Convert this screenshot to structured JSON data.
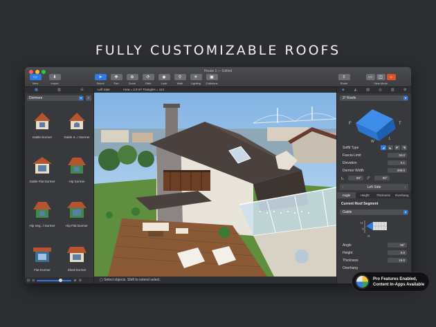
{
  "promo": {
    "title": "FULLY CUSTOMIZABLE ROOFS"
  },
  "window": {
    "document_title": "House 1 — Edited"
  },
  "toolbar": {
    "left": [
      {
        "label": "View",
        "icon": "view-icon"
      },
      {
        "label": "Import",
        "icon": "import-icon"
      }
    ],
    "tools": [
      {
        "label": "Select",
        "icon": "select-icon",
        "active": true
      },
      {
        "label": "Pan",
        "icon": "pan-icon"
      },
      {
        "label": "Zoom",
        "icon": "zoom-icon"
      },
      {
        "label": "Orbit",
        "icon": "orbit-icon"
      },
      {
        "label": "Look",
        "icon": "look-icon"
      },
      {
        "label": "Walk",
        "icon": "walk-icon"
      },
      {
        "label": "Lighting",
        "icon": "lighting-icon"
      },
      {
        "label": "Collisions",
        "icon": "collisions-icon"
      }
    ],
    "right": [
      {
        "label": "Share",
        "icon": "share-icon"
      },
      {
        "label": "View Mode",
        "icon": "view-mode-icon"
      }
    ]
  },
  "library": {
    "category": "Dormers",
    "items": [
      {
        "label": "Gable Dormer"
      },
      {
        "label": "Gable S...l Dormer"
      },
      {
        "label": "Gable Flat Dormer"
      },
      {
        "label": "Hip Dormer"
      },
      {
        "label": "Hip Seg...l Dormer"
      },
      {
        "label": "Hip Flat Dormer"
      },
      {
        "label": "Flat Dormer"
      },
      {
        "label": "Shed Dormer"
      }
    ]
  },
  "viewport": {
    "view_label": "Left Side",
    "stats": "Area = 2.9 m²   Triangles = 114",
    "status": "Select objects. Shift to extend select."
  },
  "inspector": {
    "object_type": "3° Roofs",
    "soffit_label": "Soffit Type",
    "fields": [
      {
        "label": "Fascia Limit",
        "value": "34.0"
      },
      {
        "label": "Elevation",
        "value": "0.1"
      },
      {
        "label": "Dormer Width",
        "value": "289.0"
      }
    ],
    "angle_a": "90°",
    "angle_b": "90°",
    "side": "Left Side",
    "segment_tabs": [
      "Angle",
      "Height",
      "Thickness",
      "Overhang"
    ],
    "segment_title": "Current Roof Segment",
    "segment_type": "Gable",
    "segment_fields": [
      {
        "label": "Angle",
        "value": "90°"
      },
      {
        "label": "Height",
        "value": "0.0"
      },
      {
        "label": "Thickness",
        "value": "15.0"
      },
      {
        "label": "Overhang",
        "value": ""
      }
    ]
  },
  "badge": {
    "line1": "Pro Features Enabled,",
    "line2": "Content In-Apps Available"
  },
  "colors": {
    "accent": "#2f7be6",
    "background": "#2b2d31",
    "panel": "#38393c"
  }
}
